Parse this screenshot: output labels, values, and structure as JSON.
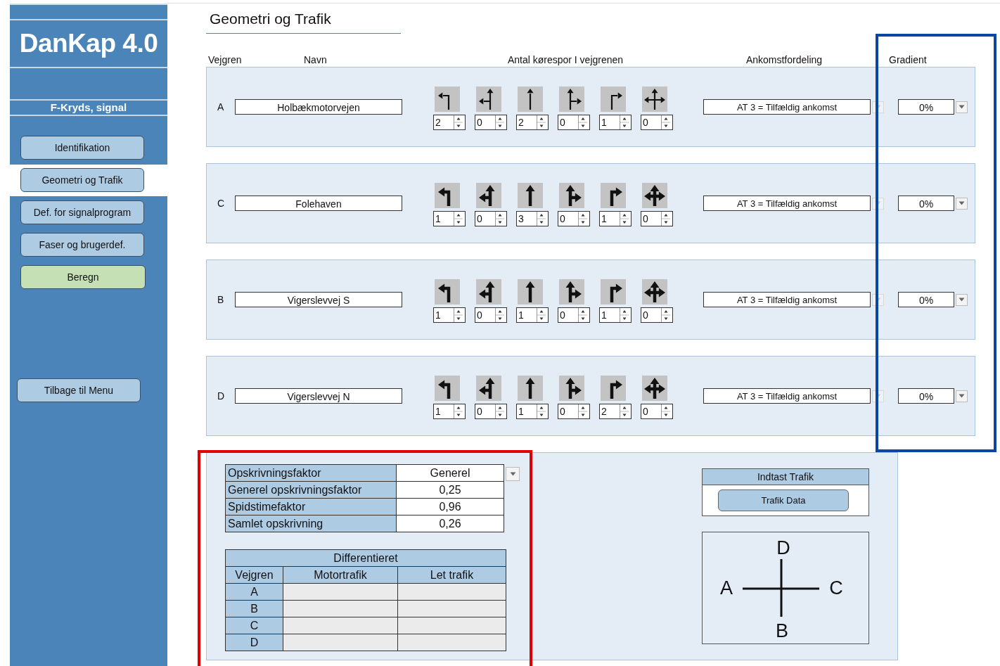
{
  "sidebar": {
    "title": "DanKap 4.0",
    "subtitle": "F-Kryds, signal",
    "items": [
      {
        "label": "Identifikation",
        "kind": "nav",
        "selected": false
      },
      {
        "label": "Geometri og Trafik",
        "kind": "nav",
        "selected": true
      },
      {
        "label": "Def. for signalprogram",
        "kind": "nav",
        "selected": false
      },
      {
        "label": "Faser og brugerdef.",
        "kind": "nav",
        "selected": false
      },
      {
        "label": "Beregn",
        "kind": "action",
        "selected": false
      }
    ],
    "back_button": "Tilbage til Menu"
  },
  "page_title": "Geometri og Trafik",
  "columns": {
    "branch": "Vejgren",
    "name": "Navn",
    "lanes": "Antal kørespor I vejgrenen",
    "arrival": "Ankomstfordeling",
    "gradient": "Gradient"
  },
  "roads": [
    {
      "branch": "A",
      "name": "Holbækmotorvejen",
      "thin_arrows": true,
      "lanes": [
        {
          "kind": "left",
          "count": "2"
        },
        {
          "kind": "straight-left",
          "count": "0"
        },
        {
          "kind": "straight",
          "count": "2"
        },
        {
          "kind": "straight-right",
          "count": "0"
        },
        {
          "kind": "right",
          "count": "1"
        },
        {
          "kind": "all",
          "count": "0"
        }
      ],
      "arrival": "AT 3 = Tilfældig ankomst",
      "gradient": "0%"
    },
    {
      "branch": "C",
      "name": "Folehaven",
      "thin_arrows": false,
      "lanes": [
        {
          "kind": "left",
          "count": "1"
        },
        {
          "kind": "straight-left",
          "count": "0"
        },
        {
          "kind": "straight",
          "count": "3"
        },
        {
          "kind": "straight-right",
          "count": "0"
        },
        {
          "kind": "right",
          "count": "1"
        },
        {
          "kind": "all",
          "count": "0"
        }
      ],
      "arrival": "AT 3 = Tilfældig ankomst",
      "gradient": "0%"
    },
    {
      "branch": "B",
      "name": "Vigerslevvej S",
      "thin_arrows": false,
      "lanes": [
        {
          "kind": "left",
          "count": "1"
        },
        {
          "kind": "straight-left",
          "count": "0"
        },
        {
          "kind": "straight",
          "count": "1"
        },
        {
          "kind": "straight-right",
          "count": "0"
        },
        {
          "kind": "right",
          "count": "1"
        },
        {
          "kind": "all",
          "count": "0"
        }
      ],
      "arrival": "AT 3 = Tilfældig ankomst",
      "gradient": "0%"
    },
    {
      "branch": "D",
      "name": "Vigerslevvej N",
      "thin_arrows": false,
      "lanes": [
        {
          "kind": "left",
          "count": "1"
        },
        {
          "kind": "straight-left",
          "count": "0"
        },
        {
          "kind": "straight",
          "count": "1"
        },
        {
          "kind": "straight-right",
          "count": "0"
        },
        {
          "kind": "right",
          "count": "2"
        },
        {
          "kind": "all",
          "count": "0"
        }
      ],
      "arrival": "AT 3 = Tilfældig ankomst",
      "gradient": "0%"
    }
  ],
  "factors": [
    {
      "label": "Opskrivningsfaktor",
      "value": "Generel",
      "dropdown": true
    },
    {
      "label": "Generel opskrivningsfaktor",
      "value": "0,25",
      "dropdown": false
    },
    {
      "label": "Spidstimefaktor",
      "value": "0,96",
      "dropdown": false
    },
    {
      "label": "Samlet opskrivning",
      "value": "0,26",
      "dropdown": false
    }
  ],
  "differentiated": {
    "title": "Differentieret",
    "columns": [
      "Vejgren",
      "Motortrafik",
      "Let trafik"
    ],
    "rows": [
      {
        "branch": "A"
      },
      {
        "branch": "B"
      },
      {
        "branch": "C"
      },
      {
        "branch": "D"
      }
    ]
  },
  "traffic_input": {
    "title": "Indtast Trafik",
    "button": "Trafik Data"
  },
  "diagram": {
    "top": "D",
    "left": "A",
    "right": "C",
    "bottom": "B"
  },
  "highlights": [
    {
      "color": "#e00000"
    },
    {
      "color": "#0b47a1"
    }
  ]
}
